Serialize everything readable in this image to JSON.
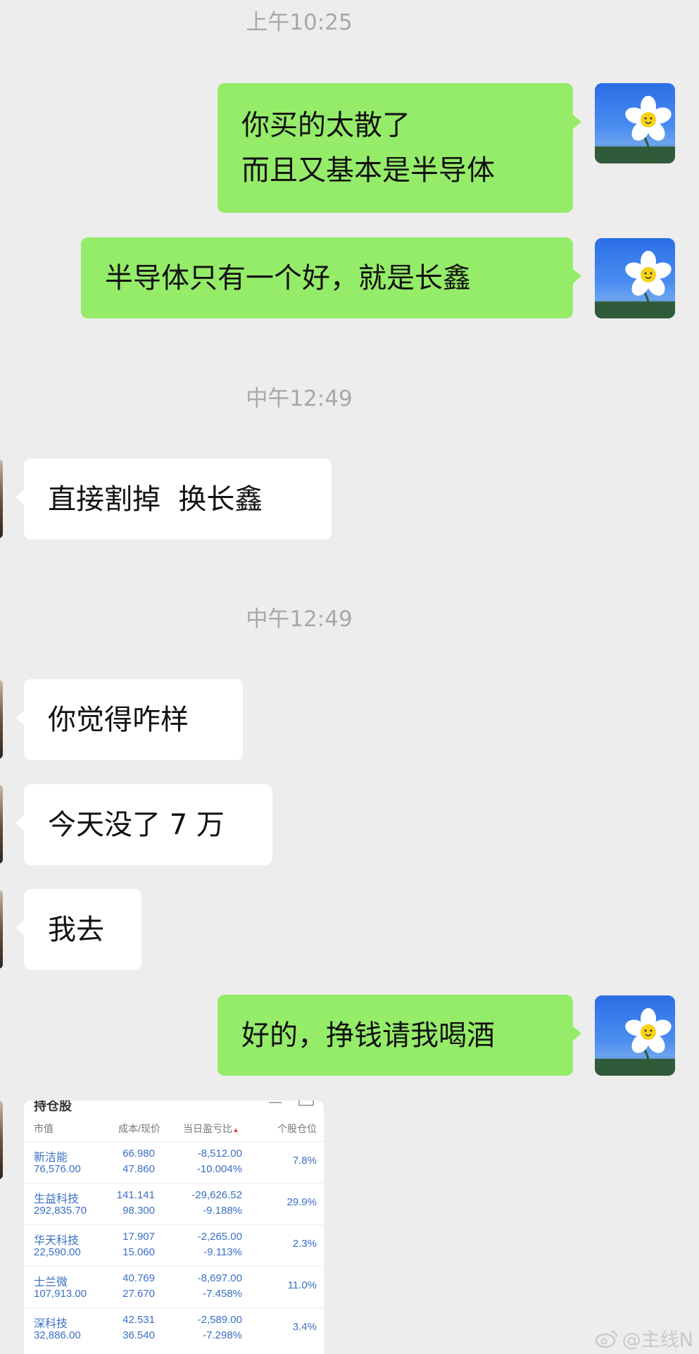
{
  "messages": {
    "ts1": "上午10:25",
    "m1_line1": "你买的太散了",
    "m1_line2": "而且又基本是半导体",
    "m2": "半导体只有一个好，就是长鑫",
    "ts2": "中午12:49",
    "m3": "直接割掉  换长鑫",
    "ts3": "中午12:49",
    "m4": "你觉得咋样",
    "m5": "今天没了 7 万",
    "m6": "我去",
    "m7": "好的，挣钱请我喝酒"
  },
  "holdings": {
    "title": "持仓股",
    "headers": {
      "market_value": "市值",
      "cost_price": "成本/现价",
      "day_pl": "当日盈亏比",
      "position": "个股仓位"
    },
    "rows": [
      {
        "name": "新洁能",
        "market_value": "76,576.00",
        "cost": "66.980",
        "price": "47.860",
        "pl": "-8,512.00",
        "pl_pct": "-10.004%",
        "position": "7.8%"
      },
      {
        "name": "生益科技",
        "market_value": "292,835.70",
        "cost": "141.141",
        "price": "98.300",
        "pl": "-29,626.52",
        "pl_pct": "-9.188%",
        "position": "29.9%"
      },
      {
        "name": "华天科技",
        "market_value": "22,590.00",
        "cost": "17.907",
        "price": "15.060",
        "pl": "-2,265.00",
        "pl_pct": "-9.113%",
        "position": "2.3%"
      },
      {
        "name": "士兰微",
        "market_value": "107,913.00",
        "cost": "40.769",
        "price": "27.670",
        "pl": "-8,697.00",
        "pl_pct": "-7.458%",
        "position": "11.0%"
      },
      {
        "name": "深科技",
        "market_value": "32,886.00",
        "cost": "42.531",
        "price": "36.540",
        "pl": "-2,589.00",
        "pl_pct": "-7.298%",
        "position": "3.4%"
      }
    ]
  },
  "watermark": "@主线N",
  "icons": {
    "avatar_right": "daisy-sky-avatar",
    "avatar_left": "contact-avatar",
    "sort": "sort-arrow-icon",
    "weibo": "weibo-logo-icon"
  },
  "colors": {
    "background": "#ededed",
    "bubble_self": "#95ec69",
    "bubble_other": "#ffffff",
    "timestamp": "#a8a8a8",
    "stock_text": "#3a6fc4"
  }
}
